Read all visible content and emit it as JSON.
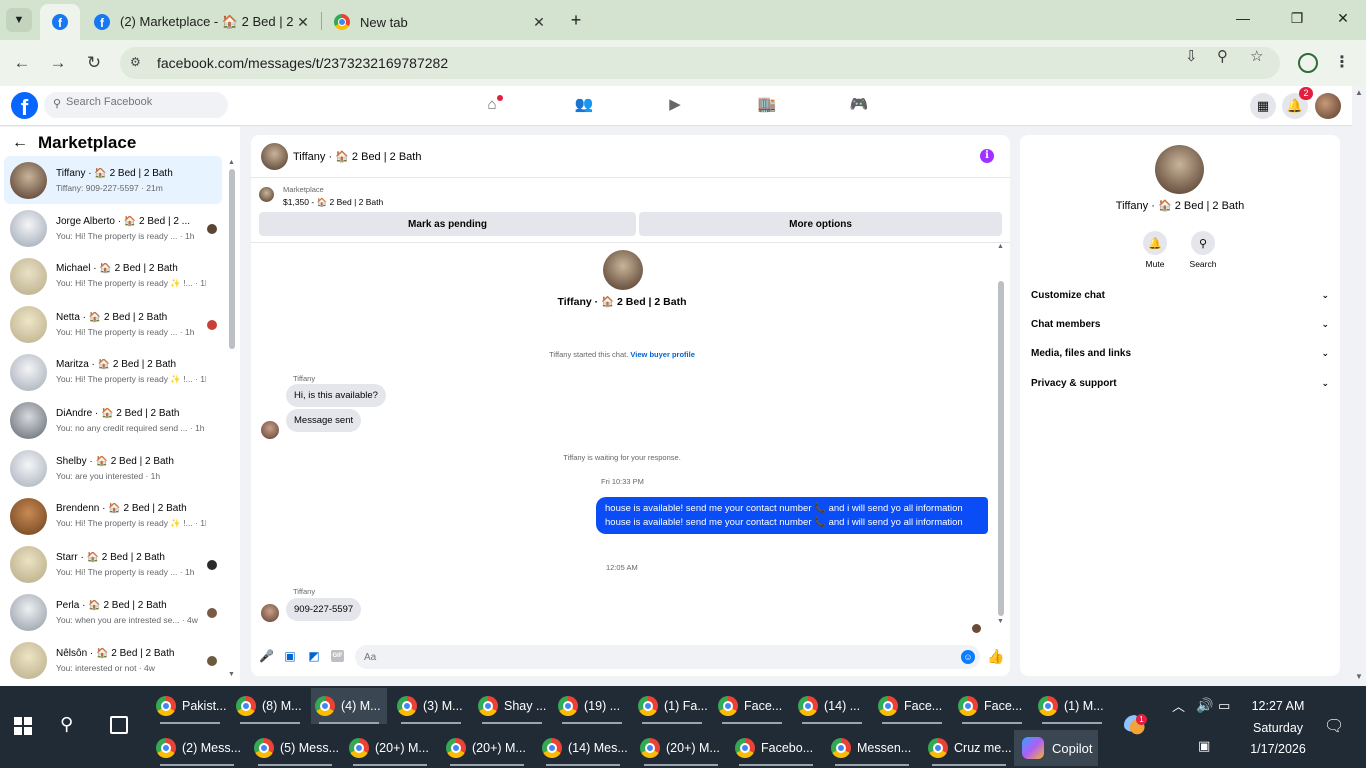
{
  "browser": {
    "tabs": [
      {
        "title": "",
        "active": true
      },
      {
        "title": "(2) Marketplace - 🏠 2 Bed | 2 Bath",
        "active": false
      },
      {
        "title": "New tab",
        "active": false
      }
    ],
    "url": "facebook.com/messages/t/2373232169787282"
  },
  "fb_header": {
    "search_placeholder": "Search Facebook",
    "notification_count": "2"
  },
  "left": {
    "title": "Marketplace",
    "conversations": [
      {
        "name": "Tiffany · 🏠 2 Bed | 2 Bath",
        "snippet": "Tiffany: 909-227-5597 · 21m",
        "selected": true
      },
      {
        "name": "Jorge Alberto · 🏠 2 Bed | 2 ...",
        "snippet": "You: Hi! The property is ready ... · 1h"
      },
      {
        "name": "Michael · 🏠 2 Bed | 2 Bath",
        "snippet": "You: Hi! The property is ready ✨ !... · 1h"
      },
      {
        "name": "Netta · 🏠 2 Bed | 2 Bath",
        "snippet": "You: Hi! The property is ready ... · 1h"
      },
      {
        "name": "Maritza · 🏠 2 Bed | 2 Bath",
        "snippet": "You: Hi! The property is ready ✨ !... · 1h"
      },
      {
        "name": "DiAndre · 🏠 2 Bed | 2 Bath",
        "snippet": "You: no any credit required send ... · 1h"
      },
      {
        "name": "Shelby · 🏠 2 Bed | 2 Bath",
        "snippet": "You: are you interested · 1h"
      },
      {
        "name": "Brendenn · 🏠 2 Bed | 2 Bath",
        "snippet": "You: Hi! The property is ready ✨ !... · 1h"
      },
      {
        "name": "Starr · 🏠 2 Bed | 2 Bath",
        "snippet": "You: Hi! The property is ready ... · 1h"
      },
      {
        "name": "Perla · 🏠 2 Bed | 2 Bath",
        "snippet": "You: when you are intrested se... · 4w"
      },
      {
        "name": "Nêlsôn · 🏠 2 Bed | 2 Bath",
        "snippet": "You: interested or not · 4w"
      }
    ]
  },
  "chat": {
    "header_name": "Tiffany · 🏠 2 Bed | 2 Bath",
    "listing_category": "Marketplace",
    "listing_title": "$1,350 - 🏠 2 Bed | 2 Bath",
    "mark_pending": "Mark as pending",
    "more_options": "More options",
    "intro_name": "Tiffany · 🏠 2 Bed | 2 Bath",
    "started_text": "Tiffany started this chat.",
    "view_profile": "View buyer profile",
    "sender1": "Tiffany",
    "msg1": "Hi, is this available?",
    "msg2": "Message sent",
    "waiting_text": "Tiffany is waiting for your response.",
    "time1": "Fri 10:33 PM",
    "outgoing": "house is available! send me your contact number 📞 and i will send yo all information house is available! send me your contact number 📞 and i will send yo all information",
    "time2": "12:05 AM",
    "sender2": "Tiffany",
    "msg3": "909-227-5597",
    "composer_placeholder": "Aa"
  },
  "info_panel": {
    "name": "Tiffany · 🏠 2 Bed | 2 Bath",
    "mute": "Mute",
    "search": "Search",
    "sections": [
      "Customize chat",
      "Chat members",
      "Media, files and links",
      "Privacy & support"
    ]
  },
  "taskbar": {
    "row1": [
      "Pakist...",
      "(8) M...",
      "(4) M...",
      "(3) M...",
      "Shay ...",
      "(19) ...",
      "(1) Fa...",
      "Face...",
      "(14) ...",
      "Face...",
      "Face...",
      "(1) M..."
    ],
    "row2": [
      "(2) Mess...",
      "(5) Mess...",
      "(20+) M...",
      "(20+) M...",
      "(14) Mes...",
      "(20+) M...",
      "Facebo...",
      "Messen...",
      "Cruz me..."
    ],
    "copilot": "Copilot",
    "weather_badge": "1",
    "time": "12:27 AM",
    "day": "Saturday",
    "date": "1/17/2026"
  }
}
